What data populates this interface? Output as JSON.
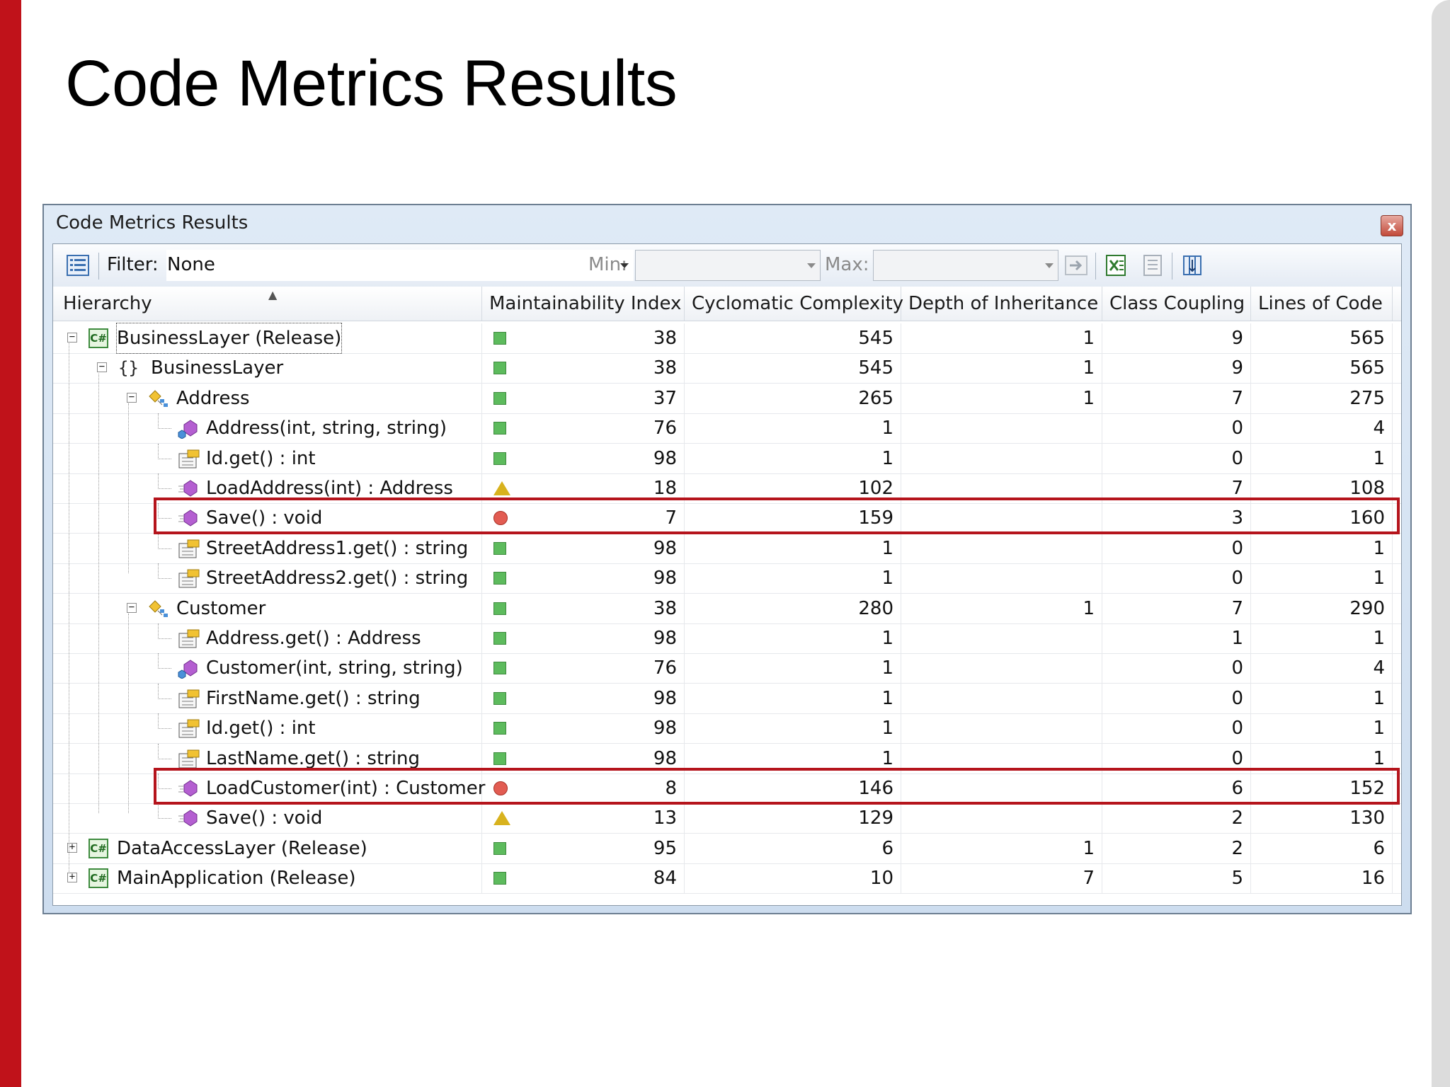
{
  "slide": {
    "title": "Code Metrics Results"
  },
  "window": {
    "title": "Code Metrics Results",
    "close_label": "x"
  },
  "toolbar": {
    "filter_label": "Filter:",
    "filter_value": "None",
    "min_label": "Min:",
    "min_value": "",
    "max_label": "Max:",
    "max_value": ""
  },
  "columns": [
    "Hierarchy",
    "Maintainability Index",
    "Cyclomatic Complexity",
    "Depth of Inheritance",
    "Class Coupling",
    "Lines of Code"
  ],
  "rows": [
    {
      "name": "BusinessLayer (Release)",
      "level": 0,
      "icon": "project-icon",
      "expand": "minus",
      "mi": "38",
      "mi_status": "green",
      "cc": "545",
      "doi": "1",
      "coupling": "9",
      "loc": "565"
    },
    {
      "name": "BusinessLayer",
      "level": 1,
      "icon": "namespace-icon",
      "expand": "minus",
      "mi": "38",
      "mi_status": "green",
      "cc": "545",
      "doi": "1",
      "coupling": "9",
      "loc": "565"
    },
    {
      "name": "Address",
      "level": 2,
      "icon": "class-icon",
      "expand": "minus",
      "mi": "37",
      "mi_status": "green",
      "cc": "265",
      "doi": "1",
      "coupling": "7",
      "loc": "275"
    },
    {
      "name": "Address(int, string, string)",
      "level": 3,
      "icon": "constructor-icon",
      "expand": "",
      "mi": "76",
      "mi_status": "green",
      "cc": "1",
      "doi": "",
      "coupling": "0",
      "loc": "4"
    },
    {
      "name": "Id.get() : int",
      "level": 3,
      "icon": "property-icon",
      "expand": "",
      "mi": "98",
      "mi_status": "green",
      "cc": "1",
      "doi": "",
      "coupling": "0",
      "loc": "1"
    },
    {
      "name": "LoadAddress(int) : Address",
      "level": 3,
      "icon": "method-icon",
      "expand": "",
      "mi": "18",
      "mi_status": "warning",
      "cc": "102",
      "doi": "",
      "coupling": "7",
      "loc": "108"
    },
    {
      "name": "Save() : void",
      "level": 3,
      "icon": "method-icon",
      "expand": "",
      "mi": "7",
      "mi_status": "red",
      "cc": "159",
      "doi": "",
      "coupling": "3",
      "loc": "160"
    },
    {
      "name": "StreetAddress1.get() : string",
      "level": 3,
      "icon": "property-icon",
      "expand": "",
      "mi": "98",
      "mi_status": "green",
      "cc": "1",
      "doi": "",
      "coupling": "0",
      "loc": "1"
    },
    {
      "name": "StreetAddress2.get() : string",
      "level": 3,
      "icon": "property-icon",
      "expand": "",
      "mi": "98",
      "mi_status": "green",
      "cc": "1",
      "doi": "",
      "coupling": "0",
      "loc": "1"
    },
    {
      "name": "Customer",
      "level": 2,
      "icon": "class-icon",
      "expand": "minus",
      "mi": "38",
      "mi_status": "green",
      "cc": "280",
      "doi": "1",
      "coupling": "7",
      "loc": "290"
    },
    {
      "name": "Address.get() : Address",
      "level": 3,
      "icon": "property-icon",
      "expand": "",
      "mi": "98",
      "mi_status": "green",
      "cc": "1",
      "doi": "",
      "coupling": "1",
      "loc": "1"
    },
    {
      "name": "Customer(int, string, string)",
      "level": 3,
      "icon": "constructor-icon",
      "expand": "",
      "mi": "76",
      "mi_status": "green",
      "cc": "1",
      "doi": "",
      "coupling": "0",
      "loc": "4"
    },
    {
      "name": "FirstName.get() : string",
      "level": 3,
      "icon": "property-icon",
      "expand": "",
      "mi": "98",
      "mi_status": "green",
      "cc": "1",
      "doi": "",
      "coupling": "0",
      "loc": "1"
    },
    {
      "name": "Id.get() : int",
      "level": 3,
      "icon": "property-icon",
      "expand": "",
      "mi": "98",
      "mi_status": "green",
      "cc": "1",
      "doi": "",
      "coupling": "0",
      "loc": "1"
    },
    {
      "name": "LastName.get() : string",
      "level": 3,
      "icon": "property-icon",
      "expand": "",
      "mi": "98",
      "mi_status": "green",
      "cc": "1",
      "doi": "",
      "coupling": "0",
      "loc": "1"
    },
    {
      "name": "LoadCustomer(int) : Customer",
      "level": 3,
      "icon": "method-icon",
      "expand": "",
      "mi": "8",
      "mi_status": "red",
      "cc": "146",
      "doi": "",
      "coupling": "6",
      "loc": "152"
    },
    {
      "name": "Save() : void",
      "level": 3,
      "icon": "method-icon",
      "expand": "",
      "mi": "13",
      "mi_status": "warning",
      "cc": "129",
      "doi": "",
      "coupling": "2",
      "loc": "130"
    },
    {
      "name": "DataAccessLayer (Release)",
      "level": 0,
      "icon": "project-icon",
      "expand": "plus",
      "mi": "95",
      "mi_status": "green",
      "cc": "6",
      "doi": "1",
      "coupling": "2",
      "loc": "6"
    },
    {
      "name": "MainApplication (Release)",
      "level": 0,
      "icon": "project-icon",
      "expand": "plus",
      "mi": "84",
      "mi_status": "green",
      "cc": "10",
      "doi": "7",
      "coupling": "5",
      "loc": "16"
    }
  ],
  "highlighted_rows": [
    6,
    15
  ],
  "colors": {
    "accent_red": "#c0121a",
    "highlight_border": "#b5141c",
    "status_green": "#5dbb5d",
    "status_red": "#e25c52",
    "status_warning": "#d8b21e"
  }
}
